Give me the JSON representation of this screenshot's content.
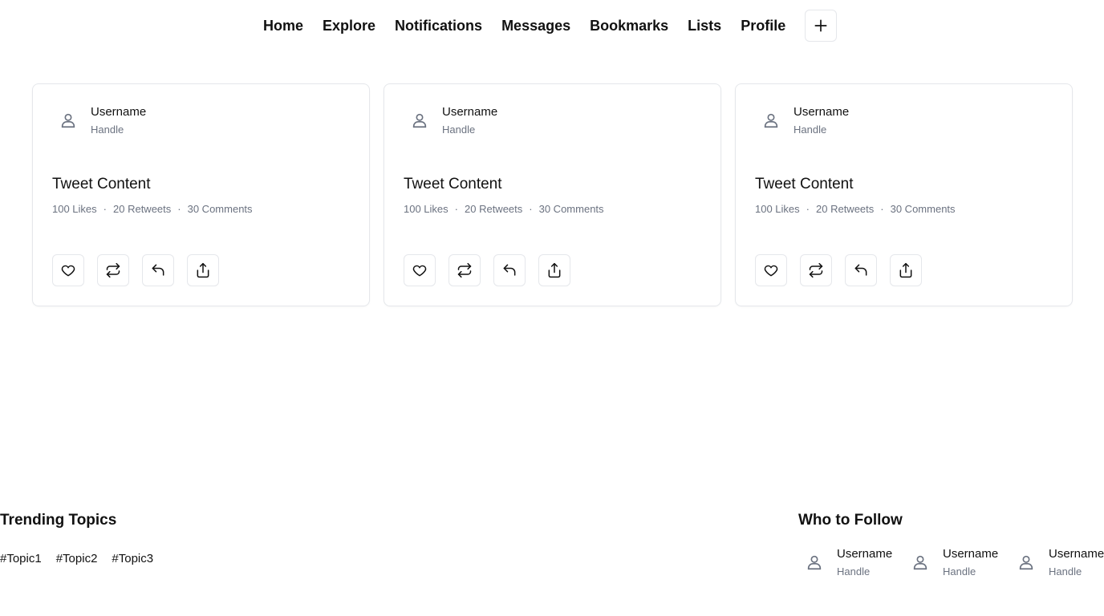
{
  "nav": {
    "items": [
      {
        "label": "Home"
      },
      {
        "label": "Explore"
      },
      {
        "label": "Notifications"
      },
      {
        "label": "Messages"
      },
      {
        "label": "Bookmarks"
      },
      {
        "label": "Lists"
      },
      {
        "label": "Profile"
      }
    ],
    "add_icon": "plus-icon"
  },
  "tweets": [
    {
      "username": "Username",
      "handle": "Handle",
      "content": "Tweet Content",
      "likes": "100 Likes",
      "retweets": "20 Retweets",
      "comments": "30 Comments",
      "separator": "·"
    },
    {
      "username": "Username",
      "handle": "Handle",
      "content": "Tweet Content",
      "likes": "100 Likes",
      "retweets": "20 Retweets",
      "comments": "30 Comments",
      "separator": "·"
    },
    {
      "username": "Username",
      "handle": "Handle",
      "content": "Tweet Content",
      "likes": "100 Likes",
      "retweets": "20 Retweets",
      "comments": "30 Comments",
      "separator": "·"
    }
  ],
  "tweet_action_icons": [
    "heart-icon",
    "repeat-icon",
    "reply-icon",
    "share-icon"
  ],
  "trending": {
    "title": "Trending Topics",
    "topics": [
      "#Topic1",
      "#Topic2",
      "#Topic3"
    ]
  },
  "who_to_follow": {
    "title": "Who to Follow",
    "users": [
      {
        "username": "Username",
        "handle": "Handle"
      },
      {
        "username": "Username",
        "handle": "Handle"
      },
      {
        "username": "Username",
        "handle": "Handle"
      }
    ]
  },
  "colors": {
    "text": "#111111",
    "muted": "#6b7280",
    "border": "#e5e7eb",
    "background": "#ffffff"
  }
}
